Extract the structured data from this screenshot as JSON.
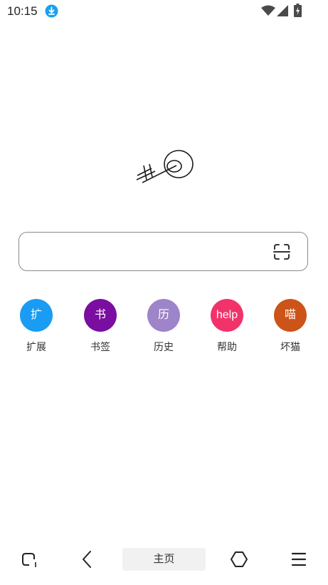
{
  "status_bar": {
    "time": "10:15"
  },
  "shortcuts": [
    {
      "icon_text": "扩",
      "label": "扩展",
      "color": "#1a9cf2"
    },
    {
      "icon_text": "书",
      "label": "书签",
      "color": "#7a0ea0"
    },
    {
      "icon_text": "历",
      "label": "历史",
      "color": "#9e84c8"
    },
    {
      "icon_text": "help",
      "label": "帮助",
      "color": "#f2336a"
    },
    {
      "icon_text": "喵",
      "label": "坏猫",
      "color": "#cc5418"
    }
  ],
  "search": {
    "placeholder": ""
  },
  "bottom_bar": {
    "home_label": "主页"
  },
  "icons": [
    "download-icon",
    "wifi-icon",
    "signal-icon",
    "battery-icon",
    "scan-icon",
    "tabs-icon",
    "back-icon",
    "home-icon",
    "menu-icon"
  ]
}
